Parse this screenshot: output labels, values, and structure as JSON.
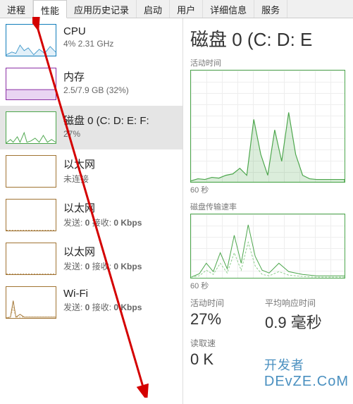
{
  "tabs": {
    "t0": "进程",
    "t1": "性能",
    "t2": "应用历史记录",
    "t3": "启动",
    "t4": "用户",
    "t5": "详细信息",
    "t6": "服务"
  },
  "sidebar": {
    "cpu": {
      "title": "CPU",
      "sub": "4% 2.31 GHz",
      "border": "#117dbb"
    },
    "mem": {
      "title": "内存",
      "sub": "2.5/7.9 GB (32%)",
      "border": "#8b2fa5"
    },
    "disk": {
      "title": "磁盘 0 (C: D: E: F:",
      "sub": "27%",
      "border": "#4ca64c"
    },
    "eth0": {
      "title": "以太网",
      "sub": "未连接",
      "border": "#a17433"
    },
    "eth1": {
      "title": "以太网",
      "sub_pre": "发送: ",
      "sub_mid": "0",
      "sub_mid2": " 接收: ",
      "sub_end": "0 Kbps",
      "border": "#a17433"
    },
    "eth2": {
      "title": "以太网",
      "sub_pre": "发送: ",
      "sub_mid": "0",
      "sub_mid2": " 接收: ",
      "sub_end": "0 Kbps",
      "border": "#a17433"
    },
    "wifi": {
      "title": "Wi-Fi",
      "sub_pre": "发送: ",
      "sub_mid": "0",
      "sub_mid2": " 接收: ",
      "sub_end": "0 Kbps",
      "border": "#a17433"
    }
  },
  "detail": {
    "title": "磁盘 0 (C: D: E",
    "activity_label": "活动时间",
    "axis_60s": "60 秒",
    "transfer_label": "磁盘传输速率",
    "stats": {
      "active_label": "活动时间",
      "active_value": "27%",
      "latency_label": "平均响应时间",
      "latency_value": "0.9 毫秒",
      "read_label": "读取速",
      "read_value": "0 K"
    }
  },
  "chart_data": [
    {
      "type": "line",
      "name": "disk-activity-time",
      "title": "活动时间",
      "xlabel": "",
      "ylabel": "",
      "xlim": [
        0,
        60
      ],
      "ylim": [
        0,
        100
      ],
      "x_axis_note": "60 秒",
      "values": [
        4,
        3,
        5,
        6,
        5,
        4,
        3,
        6,
        8,
        12,
        10,
        6,
        3,
        2,
        3,
        4,
        60,
        30,
        10,
        8,
        6,
        40,
        20,
        12,
        50,
        25,
        10,
        6,
        4,
        2,
        2,
        3,
        2,
        2,
        2,
        2,
        2,
        2,
        2,
        2
      ]
    },
    {
      "type": "line",
      "name": "disk-transfer-rate",
      "title": "磁盘传输速率",
      "xlabel": "",
      "ylabel": "",
      "xlim": [
        0,
        60
      ],
      "ylim": [
        0,
        100
      ],
      "x_axis_note": "60 秒",
      "series": [
        {
          "name": "line1",
          "values": [
            2,
            4,
            12,
            8,
            5,
            4,
            30,
            15,
            6,
            45,
            20,
            8,
            5,
            55,
            25,
            10,
            6,
            4,
            3,
            5,
            8,
            6,
            4,
            3,
            2,
            2,
            3,
            2
          ]
        },
        {
          "name": "line2",
          "values": [
            1,
            2,
            6,
            4,
            3,
            2,
            18,
            9,
            4,
            28,
            12,
            5,
            3,
            35,
            15,
            6,
            4,
            3,
            2,
            3,
            5,
            4,
            3,
            2,
            1,
            1,
            2,
            1
          ]
        }
      ]
    }
  ],
  "watermark": {
    "cn": "开发者",
    "en": "DEvZE.CoM"
  }
}
